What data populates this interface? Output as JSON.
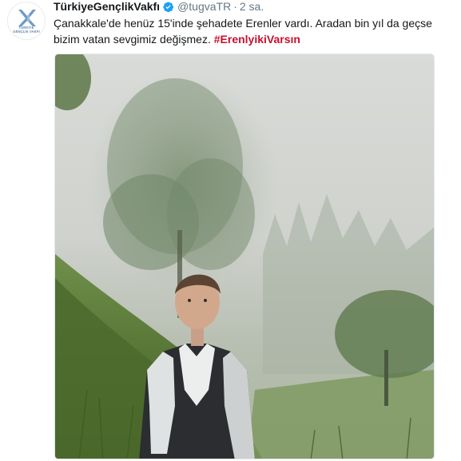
{
  "tweet": {
    "display_name": "TürkiyeGençlikVakfı",
    "handle": "@tugvaTR",
    "separator": "·",
    "timestamp": "2 sa.",
    "text_main": "Çanakkale'de henüz 15'inde şehadete Erenler vardı. Aradan bin yıl da geçse bizim vatan sevgimiz değişmez.",
    "hashtag": "#ErenlyikiVarsın",
    "verified_icon": "verified-badge-icon",
    "avatar": {
      "line1": "TÜRKİYE",
      "line2": "GENÇLİK VAKFI",
      "brand_color": "#5a86b2"
    },
    "media": {
      "icon": "photo-icon"
    }
  },
  "colors": {
    "hashtag": "#c8102e",
    "secondary_text": "#657786",
    "verified": "#1da1f2"
  }
}
